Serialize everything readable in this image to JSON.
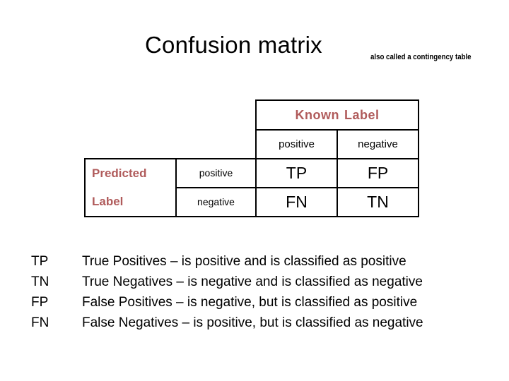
{
  "title": {
    "main": "Confusion matrix",
    "subtitle": "also called a contingency table"
  },
  "colors": {
    "header_accent": "#b05b5b",
    "text": "#000000",
    "border": "#000000",
    "background": "#ffffff"
  },
  "matrix": {
    "known_label_header": "Known  Label",
    "known_label_header_part1": "Known",
    "known_label_header_part2": "Label",
    "predicted_label_header_line1": "Predicted",
    "predicted_label_header_line2": "Label",
    "column_headers": [
      "positive",
      "negative"
    ],
    "row_headers": [
      "positive",
      "negative"
    ],
    "cells": [
      [
        "TP",
        "FP"
      ],
      [
        "FN",
        "TN"
      ]
    ]
  },
  "legend": {
    "rows": [
      {
        "abbr": "TP",
        "description": "True Positives – is positive and is classified as positive"
      },
      {
        "abbr": "TN",
        "description": "True Negatives – is negative and is classified as negative"
      },
      {
        "abbr": "FP",
        "description": "False Positives – is negative, but is classified as positive"
      },
      {
        "abbr": "FN",
        "description": "False Negatives – is positive, but is classified as negative"
      }
    ]
  }
}
